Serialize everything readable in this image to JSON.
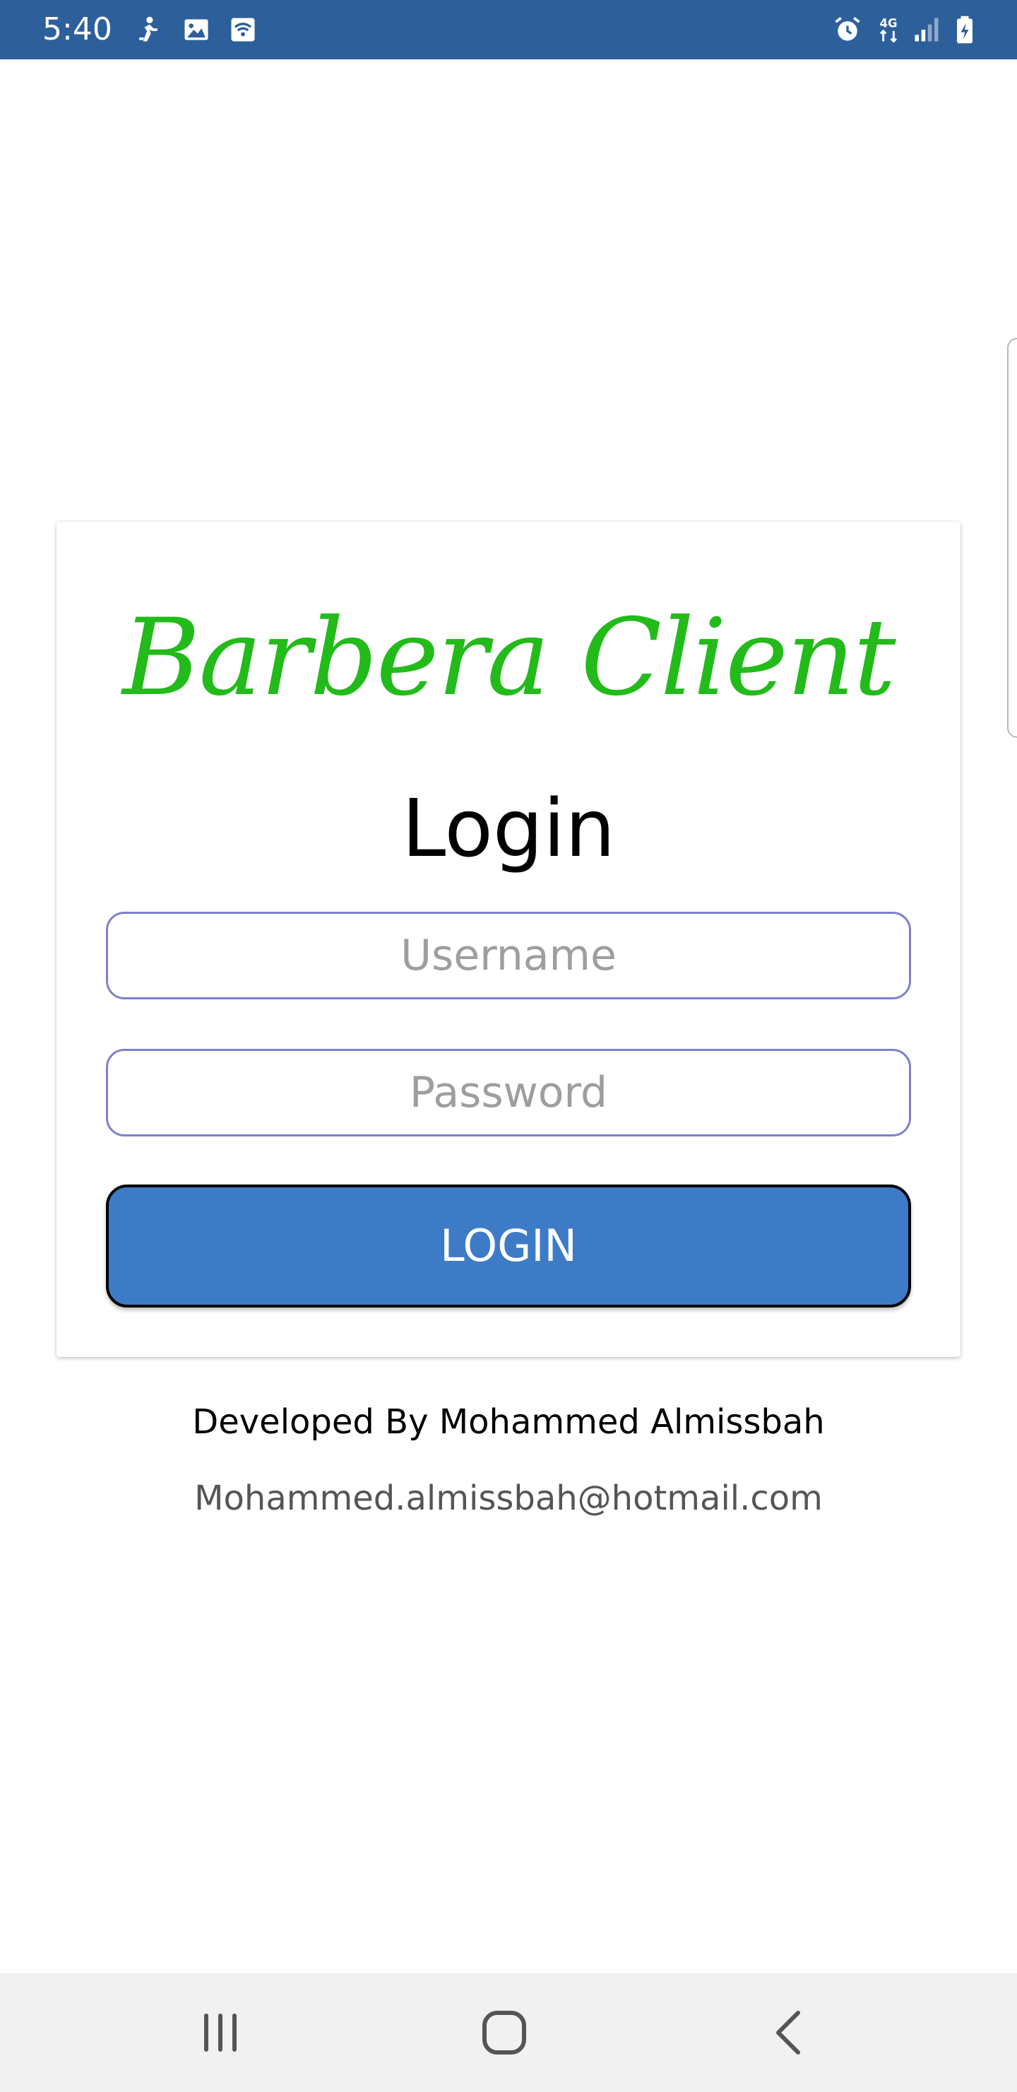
{
  "status_bar": {
    "time": "5:40",
    "background_color": "#2d5f9b",
    "left_icons": [
      "notification-figure-icon",
      "gallery-icon",
      "wifi-calling-icon"
    ],
    "right_icons": [
      "alarm-icon",
      "mobile-data-4g-icon",
      "signal-icon",
      "battery-charging-icon"
    ],
    "network_label": "4G"
  },
  "card": {
    "brand_title": "Barbera Client",
    "brand_color": "#22bb1a",
    "heading": "Login",
    "username": {
      "placeholder": "Username",
      "value": ""
    },
    "password": {
      "placeholder": "Password",
      "value": ""
    },
    "login_button": {
      "label": "LOGIN",
      "color": "#3d7bc6"
    }
  },
  "footer": {
    "developer": "Developed By Mohammed Almissbah",
    "email": "Mohammed.almissbah@hotmail.com"
  },
  "nav_bar": {
    "buttons": [
      "recents-icon",
      "home-icon",
      "back-icon"
    ]
  }
}
